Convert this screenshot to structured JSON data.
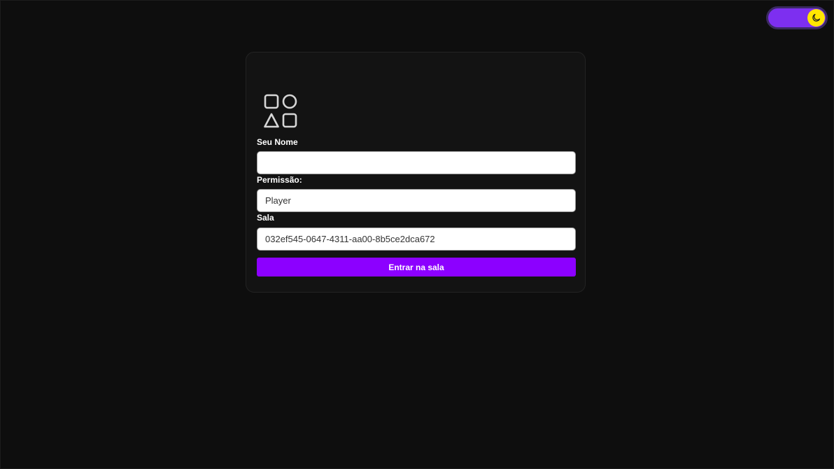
{
  "theme_toggle": {
    "mode": "dark",
    "icon": "moon-icon",
    "track_color": "#7d2ff0",
    "knob_color": "#ffe600"
  },
  "form": {
    "logo_icon": "shapes-icon",
    "name": {
      "label": "Seu Nome",
      "value": ""
    },
    "permission": {
      "label": "Permissão:",
      "value": "Player"
    },
    "room": {
      "label": "Sala",
      "value": "032ef545-0647-4311-aa00-8b5ce2dca672"
    },
    "submit_label": "Entrar na sala",
    "accent_color": "#8c00ff"
  }
}
